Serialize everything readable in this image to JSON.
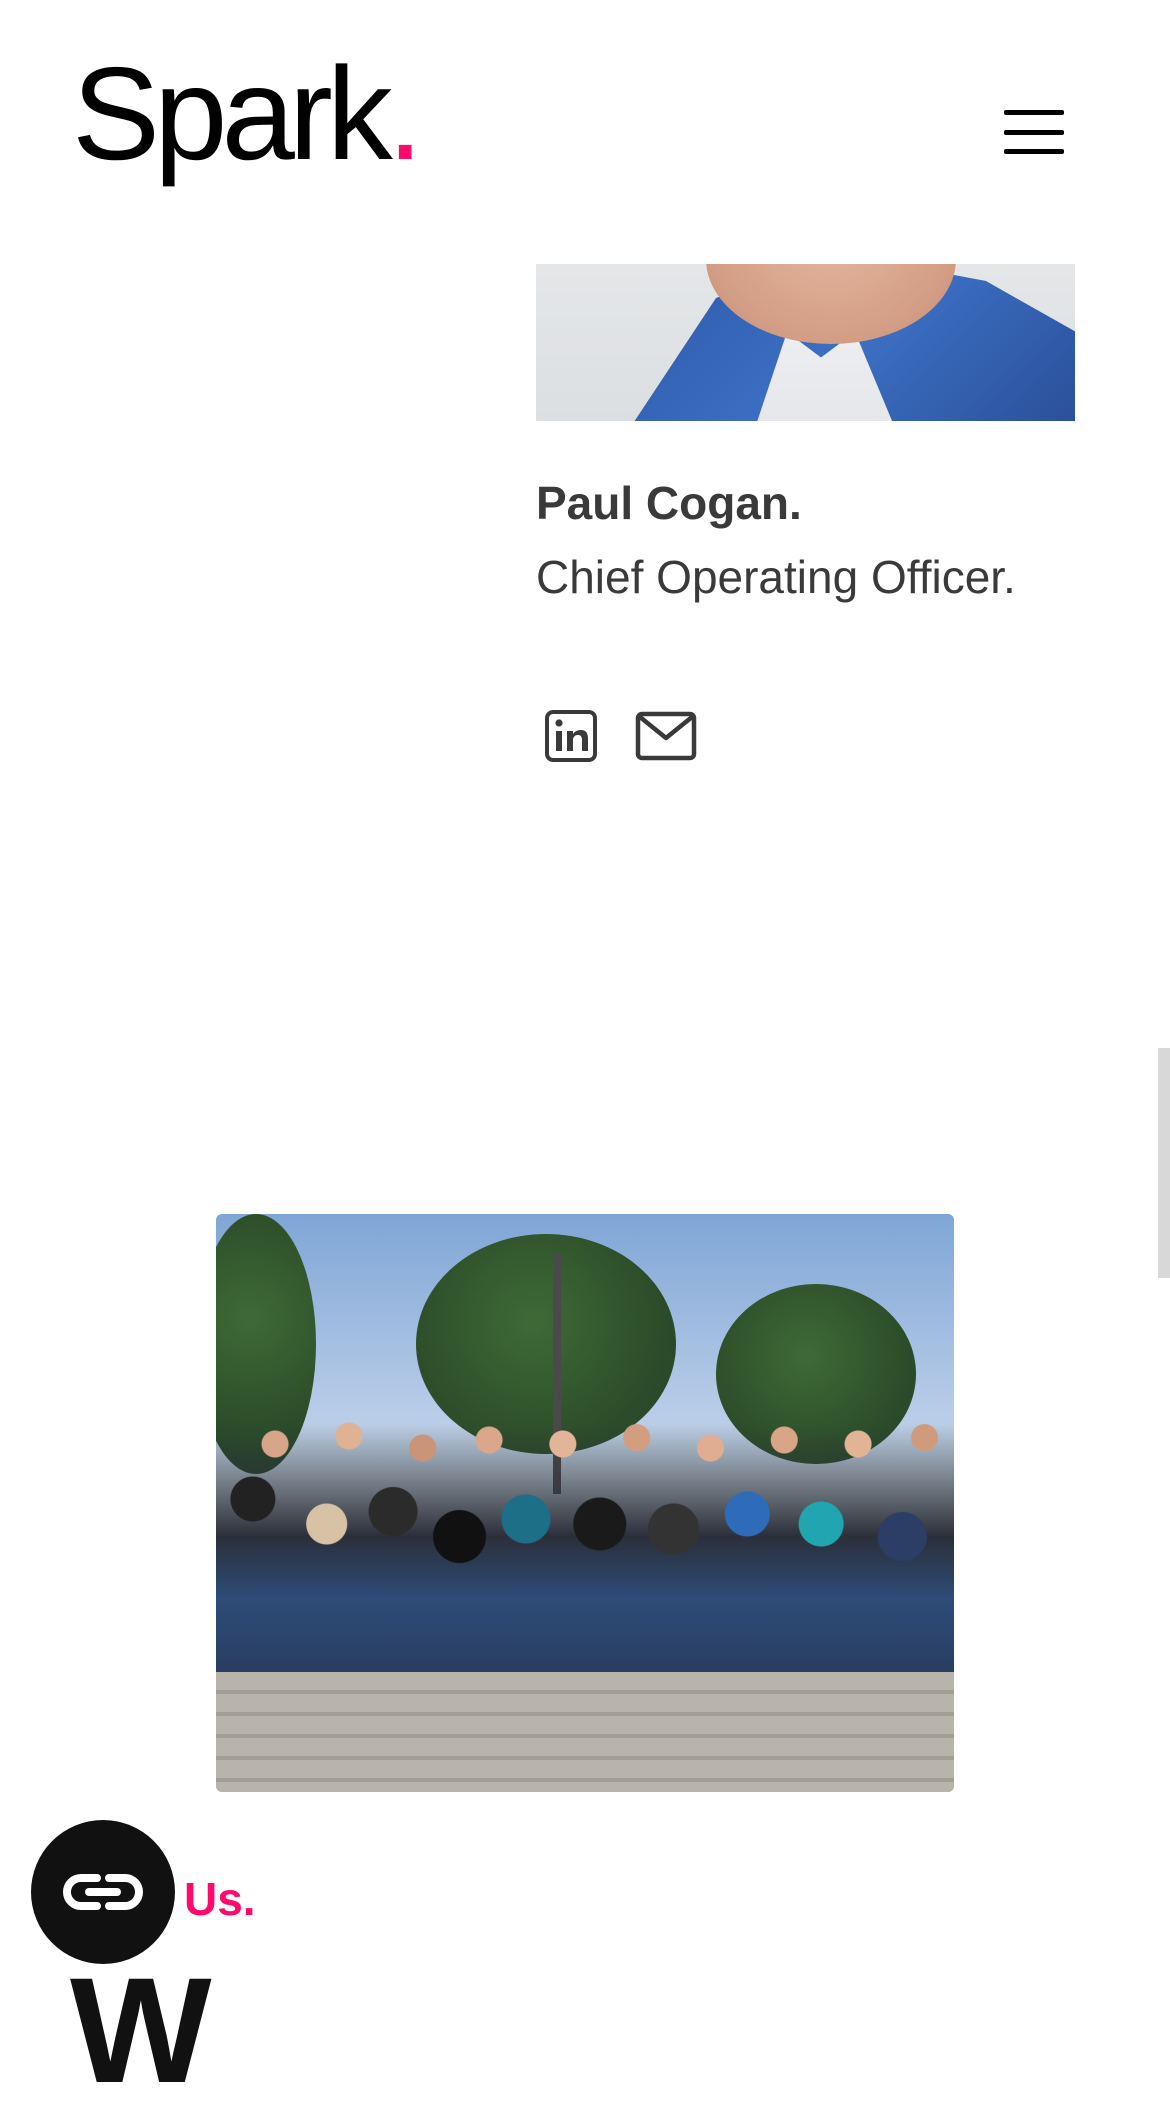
{
  "header": {
    "logo_text": "Spark",
    "logo_dot": ".",
    "menu_icon": "hamburger-menu-icon"
  },
  "team_member": {
    "name": "Paul Cogan.",
    "role": "Chief Operating Officer.",
    "social": [
      {
        "icon": "linkedin-icon"
      },
      {
        "icon": "mail-icon"
      }
    ]
  },
  "section": {
    "label": "Us.",
    "heading_partial": "W"
  },
  "chat": {
    "icon": "chat-logo-icon"
  },
  "colors": {
    "accent": "#ff0a6c",
    "text": "#3a3a3a",
    "dark": "#111111"
  }
}
